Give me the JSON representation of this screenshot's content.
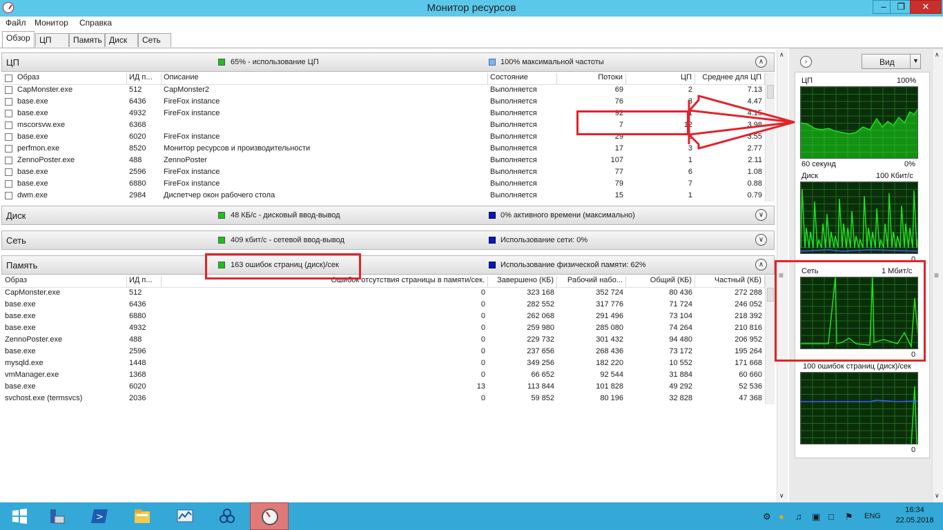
{
  "window": {
    "title": "Монитор ресурсов"
  },
  "menu": [
    "Файл",
    "Монитор",
    "Справка"
  ],
  "tabs": [
    "Обзор",
    "ЦП",
    "Память",
    "Диск",
    "Сеть"
  ],
  "cpu": {
    "title": "ЦП",
    "metric1": "65% - использование ЦП",
    "metric2": "100% максимальной частоты",
    "columns": [
      "Образ",
      "ИД п...",
      "Описание",
      "Состояние",
      "Потоки",
      "ЦП",
      "Среднее для ЦП"
    ],
    "rows": [
      [
        "CapMonster.exe",
        "512",
        "CapMonster2",
        "Выполняется",
        "69",
        "2",
        "7.13"
      ],
      [
        "base.exe",
        "6436",
        "FireFox instance",
        "Выполняется",
        "76",
        "3",
        "4.47"
      ],
      [
        "base.exe",
        "4932",
        "FireFox instance",
        "Выполняется",
        "92",
        "1",
        "4.15"
      ],
      [
        "mscorsvw.exe",
        "6368",
        "",
        "Выполняется",
        "7",
        "12",
        "3.98"
      ],
      [
        "base.exe",
        "6020",
        "FireFox instance",
        "Выполняется",
        "29",
        "2",
        "3.55"
      ],
      [
        "perfmon.exe",
        "8520",
        "Монитор ресурсов и производительности",
        "Выполняется",
        "17",
        "3",
        "2.77"
      ],
      [
        "ZennoPoster.exe",
        "488",
        "ZennoPoster",
        "Выполняется",
        "107",
        "1",
        "2.11"
      ],
      [
        "base.exe",
        "2596",
        "FireFox instance",
        "Выполняется",
        "77",
        "6",
        "1.08"
      ],
      [
        "base.exe",
        "6880",
        "FireFox instance",
        "Выполняется",
        "79",
        "7",
        "0.88"
      ],
      [
        "dwm.exe",
        "2984",
        "Диспетчер окон рабочего стола",
        "Выполняется",
        "15",
        "1",
        "0.79"
      ]
    ]
  },
  "disk": {
    "title": "Диск",
    "metric1": "48 КБ/с - дисковый ввод-вывод",
    "metric2": "0% активного времени (максимально)"
  },
  "net": {
    "title": "Сеть",
    "metric1": "409 кбит/с - сетевой ввод-вывод",
    "metric2": "Использование сети: 0%"
  },
  "memory": {
    "title": "Память",
    "metric1": "163 ошибок страниц (диск)/сек",
    "metric2": "Использование физической памяти: 62%",
    "columns": [
      "Образ",
      "ИД п...",
      "Ошибок отсутствия страницы в памяти/сек.",
      "Завершено (КБ)",
      "Рабочий набо...",
      "Общий (КБ)",
      "Частный (КБ)"
    ],
    "rows": [
      [
        "CapMonster.exe",
        "512",
        "0",
        "323 168",
        "352 724",
        "80 436",
        "272 288"
      ],
      [
        "base.exe",
        "6436",
        "0",
        "282 552",
        "317 776",
        "71 724",
        "246 052"
      ],
      [
        "base.exe",
        "6880",
        "0",
        "262 068",
        "291 496",
        "73 104",
        "218 392"
      ],
      [
        "base.exe",
        "4932",
        "0",
        "259 980",
        "285 080",
        "74 264",
        "210 816"
      ],
      [
        "ZennoPoster.exe",
        "488",
        "0",
        "229 732",
        "301 432",
        "94 480",
        "206 952"
      ],
      [
        "base.exe",
        "2596",
        "0",
        "237 656",
        "268 436",
        "73 172",
        "195 264"
      ],
      [
        "mysqld.exe",
        "1448",
        "0",
        "349 256",
        "182 220",
        "10 552",
        "171 668"
      ],
      [
        "vmManager.exe",
        "1368",
        "0",
        "66 652",
        "92 544",
        "31 884",
        "60 660"
      ],
      [
        "base.exe",
        "6020",
        "13",
        "113 844",
        "101 828",
        "49 292",
        "52 536"
      ],
      [
        "svchost.exe (termsvcs)",
        "2036",
        "0",
        "59 852",
        "80 196",
        "32 828",
        "47 368"
      ]
    ]
  },
  "right_pane": {
    "view_label": "Вид",
    "graphs": [
      {
        "title": "ЦП",
        "max": "100%",
        "footer_left": "60 секунд",
        "footer_right": "0%"
      },
      {
        "title": "Диск",
        "max": "100 Кбит/с",
        "footer_left": "",
        "footer_right": "0"
      },
      {
        "title": "Сеть",
        "max": "1 Мбит/с",
        "footer_left": "",
        "footer_right": "0"
      },
      {
        "title": "100 ошибок страниц (диск)/сек",
        "max": "",
        "footer_left": "",
        "footer_right": "0"
      }
    ]
  },
  "taskbar": {
    "language": "ENG",
    "time": "16:34",
    "date": "22.05.2018",
    "icons": [
      "start-icon",
      "server-manager-icon",
      "powershell-icon",
      "file-explorer-icon",
      "performance-monitor-icon",
      "network-app-icon",
      "resource-monitor-icon"
    ]
  },
  "colors": {
    "titlebar": "#5bc8ea",
    "taskbar": "#34a9d8",
    "graph_bg": "#0a2e0a",
    "graph_line": "#1ee31e",
    "annotation": "#e32229"
  }
}
